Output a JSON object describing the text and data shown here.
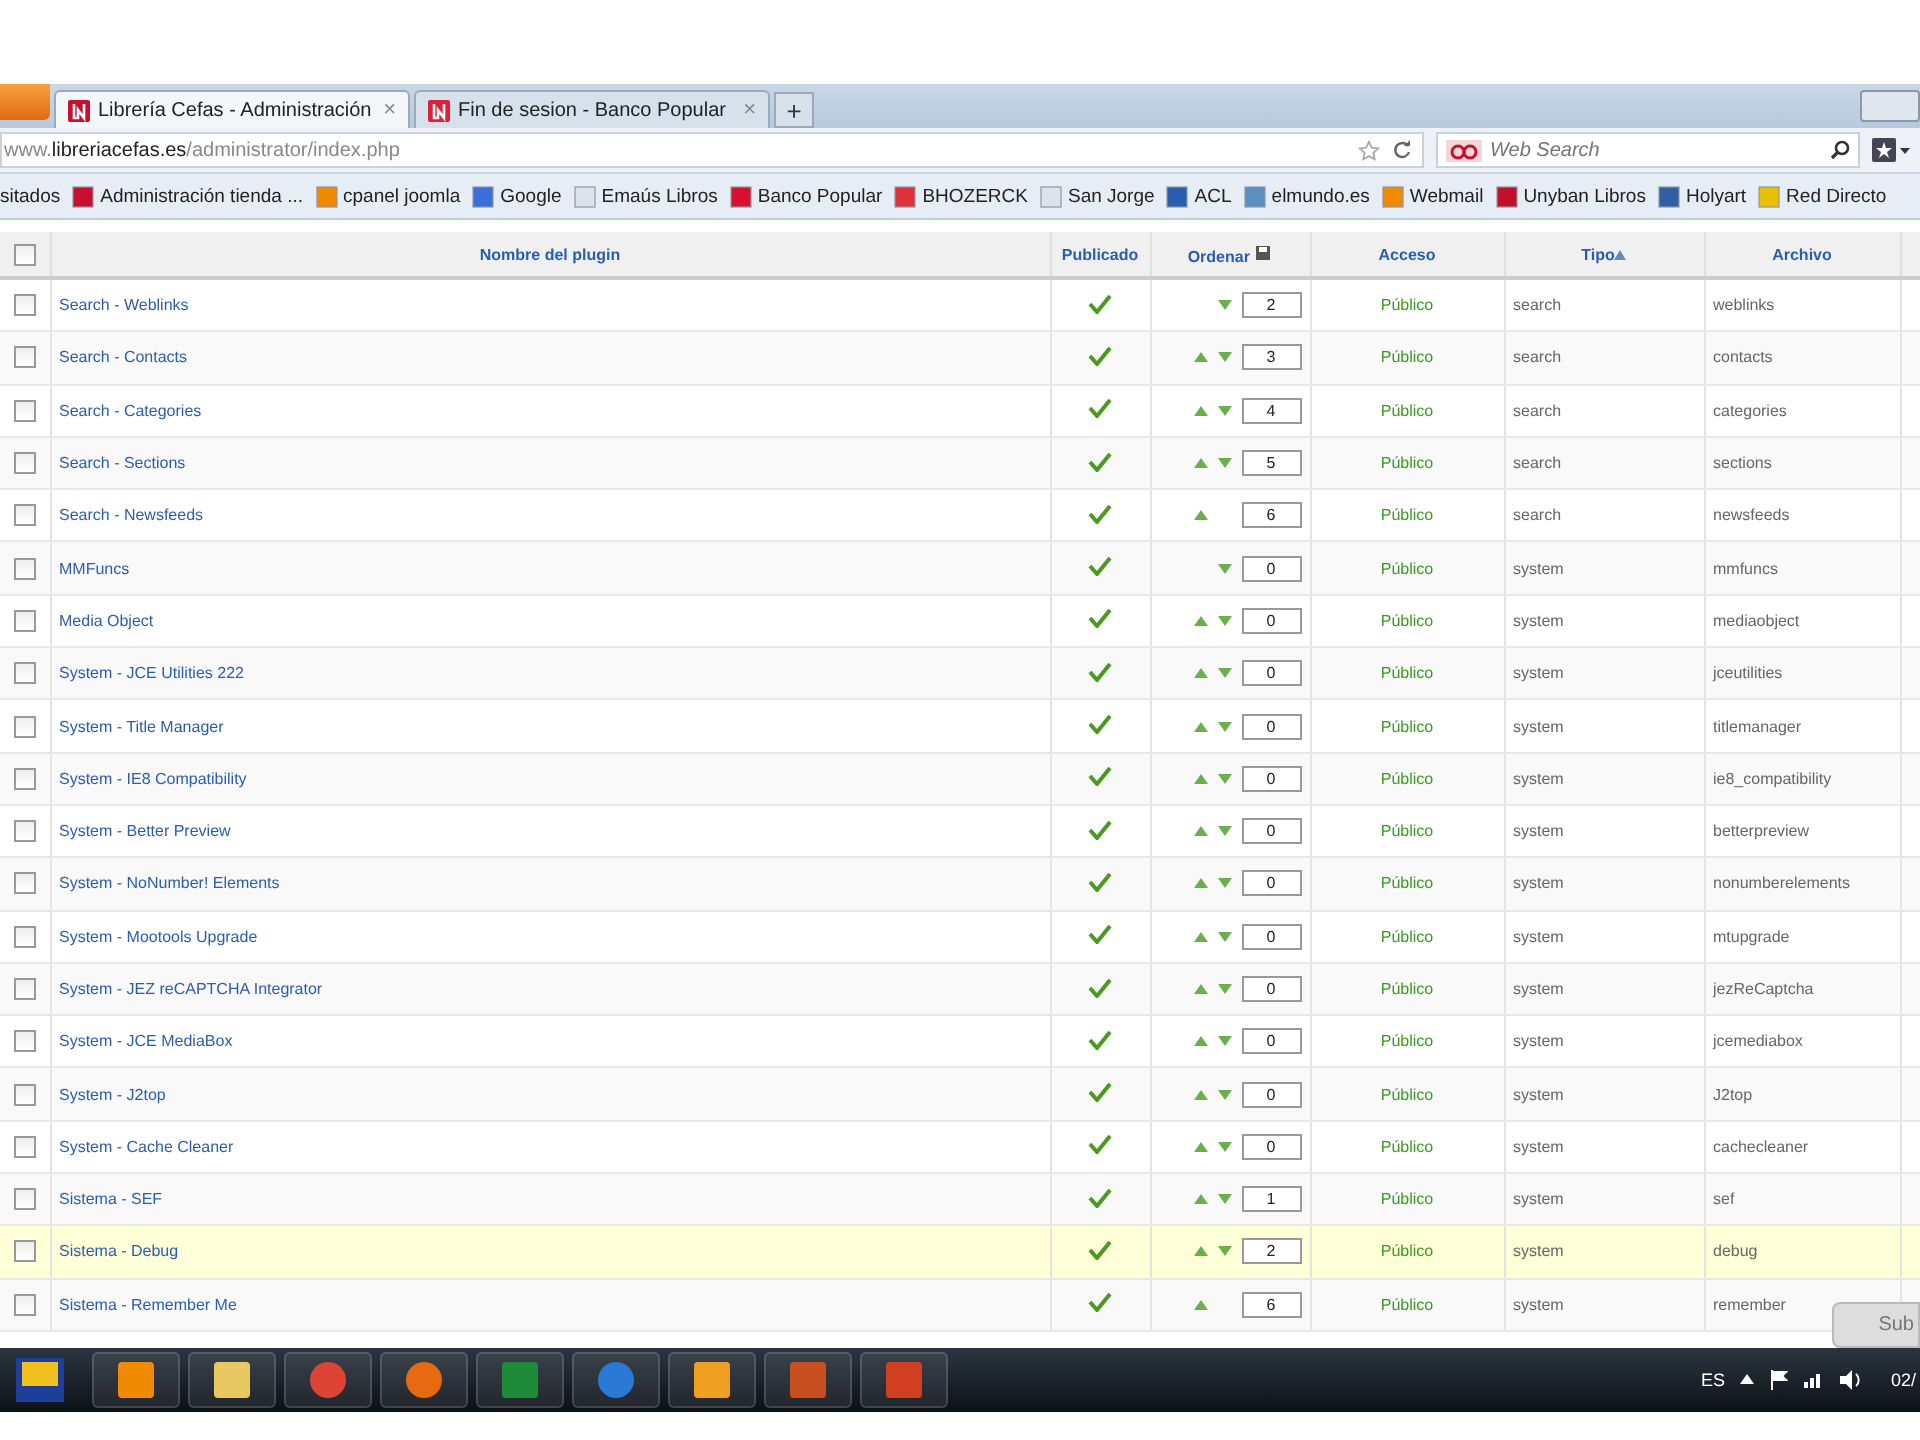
{
  "browser": {
    "tabs": [
      {
        "title": "Librería Cefas - Administración",
        "close": "×",
        "selected": true
      },
      {
        "title": "Fin de sesion - Banco Popular",
        "close": "×",
        "selected": false
      }
    ],
    "new_tab": "+",
    "address": {
      "prefix": "www.",
      "domain": "libreriacefas.es",
      "path": "/administrator/index.php"
    },
    "search": {
      "placeholder": "Web Search"
    },
    "bookmarks": [
      "sitados",
      "Administración tienda ...",
      "cpanel joomla",
      "Google",
      "Emaús Libros",
      "Banco Popular",
      "BHOZERCK",
      "San Jorge",
      "ACL",
      "elmundo.es",
      "Webmail",
      "Unyban Libros",
      "Holyart",
      "Red Directo"
    ]
  },
  "table": {
    "select_all_checked": false,
    "columns": [
      "Nombre del plugin",
      "Publicado",
      "Ordenar",
      "Acceso",
      "Tipo",
      "Archivo"
    ],
    "rows": [
      {
        "name": "Search - Weblinks",
        "checked": false,
        "published": true,
        "up": false,
        "down": true,
        "order": "2",
        "access": "Público",
        "type": "search",
        "file": "weblinks",
        "highlighted": false
      },
      {
        "name": "Search - Contacts",
        "checked": false,
        "published": true,
        "up": true,
        "down": true,
        "order": "3",
        "access": "Público",
        "type": "search",
        "file": "contacts",
        "highlighted": false
      },
      {
        "name": "Search - Categories",
        "checked": false,
        "published": true,
        "up": true,
        "down": true,
        "order": "4",
        "access": "Público",
        "type": "search",
        "file": "categories",
        "highlighted": false
      },
      {
        "name": "Search - Sections",
        "checked": false,
        "published": true,
        "up": true,
        "down": true,
        "order": "5",
        "access": "Público",
        "type": "search",
        "file": "sections",
        "highlighted": false
      },
      {
        "name": "Search - Newsfeeds",
        "checked": false,
        "published": true,
        "up": true,
        "down": false,
        "order": "6",
        "access": "Público",
        "type": "search",
        "file": "newsfeeds",
        "highlighted": false
      },
      {
        "name": "MMFuncs",
        "checked": false,
        "published": true,
        "up": false,
        "down": true,
        "order": "0",
        "access": "Público",
        "type": "system",
        "file": "mmfuncs",
        "highlighted": false
      },
      {
        "name": "Media Object",
        "checked": false,
        "published": true,
        "up": true,
        "down": true,
        "order": "0",
        "access": "Público",
        "type": "system",
        "file": "mediaobject",
        "highlighted": false
      },
      {
        "name": "System - JCE Utilities 222",
        "checked": false,
        "published": true,
        "up": true,
        "down": true,
        "order": "0",
        "access": "Público",
        "type": "system",
        "file": "jceutilities",
        "highlighted": false
      },
      {
        "name": "System - Title Manager",
        "checked": false,
        "published": true,
        "up": true,
        "down": true,
        "order": "0",
        "access": "Público",
        "type": "system",
        "file": "titlemanager",
        "highlighted": false
      },
      {
        "name": "System - IE8 Compatibility",
        "checked": false,
        "published": true,
        "up": true,
        "down": true,
        "order": "0",
        "access": "Público",
        "type": "system",
        "file": "ie8_compatibility",
        "highlighted": false
      },
      {
        "name": "System - Better Preview",
        "checked": false,
        "published": true,
        "up": true,
        "down": true,
        "order": "0",
        "access": "Público",
        "type": "system",
        "file": "betterpreview",
        "highlighted": false
      },
      {
        "name": "System - NoNumber! Elements",
        "checked": false,
        "published": true,
        "up": true,
        "down": true,
        "order": "0",
        "access": "Público",
        "type": "system",
        "file": "nonumberelements",
        "highlighted": false
      },
      {
        "name": "System - Mootools Upgrade",
        "checked": false,
        "published": true,
        "up": true,
        "down": true,
        "order": "0",
        "access": "Público",
        "type": "system",
        "file": "mtupgrade",
        "highlighted": false
      },
      {
        "name": "System - JEZ reCAPTCHA Integrator",
        "checked": false,
        "published": true,
        "up": true,
        "down": true,
        "order": "0",
        "access": "Público",
        "type": "system",
        "file": "jezReCaptcha",
        "highlighted": false
      },
      {
        "name": "System - JCE MediaBox",
        "checked": false,
        "published": true,
        "up": true,
        "down": true,
        "order": "0",
        "access": "Público",
        "type": "system",
        "file": "jcemediabox",
        "highlighted": false
      },
      {
        "name": "System - J2top",
        "checked": false,
        "published": true,
        "up": true,
        "down": true,
        "order": "0",
        "access": "Público",
        "type": "system",
        "file": "J2top",
        "highlighted": false
      },
      {
        "name": "System - Cache Cleaner",
        "checked": false,
        "published": true,
        "up": true,
        "down": true,
        "order": "0",
        "access": "Público",
        "type": "system",
        "file": "cachecleaner",
        "highlighted": false
      },
      {
        "name": "Sistema - SEF",
        "checked": false,
        "published": true,
        "up": true,
        "down": true,
        "order": "1",
        "access": "Público",
        "type": "system",
        "file": "sef",
        "highlighted": false
      },
      {
        "name": "Sistema - Debug",
        "checked": false,
        "published": true,
        "up": true,
        "down": true,
        "order": "2",
        "access": "Público",
        "type": "system",
        "file": "debug",
        "highlighted": true
      },
      {
        "name": "Sistema - Remember Me",
        "checked": false,
        "published": true,
        "up": true,
        "down": false,
        "order": "6",
        "access": "Público",
        "type": "system",
        "file": "remember",
        "highlighted": false
      }
    ]
  },
  "submit_button": "Sub",
  "taskbar": {
    "language": "ES",
    "clock": "02/"
  }
}
